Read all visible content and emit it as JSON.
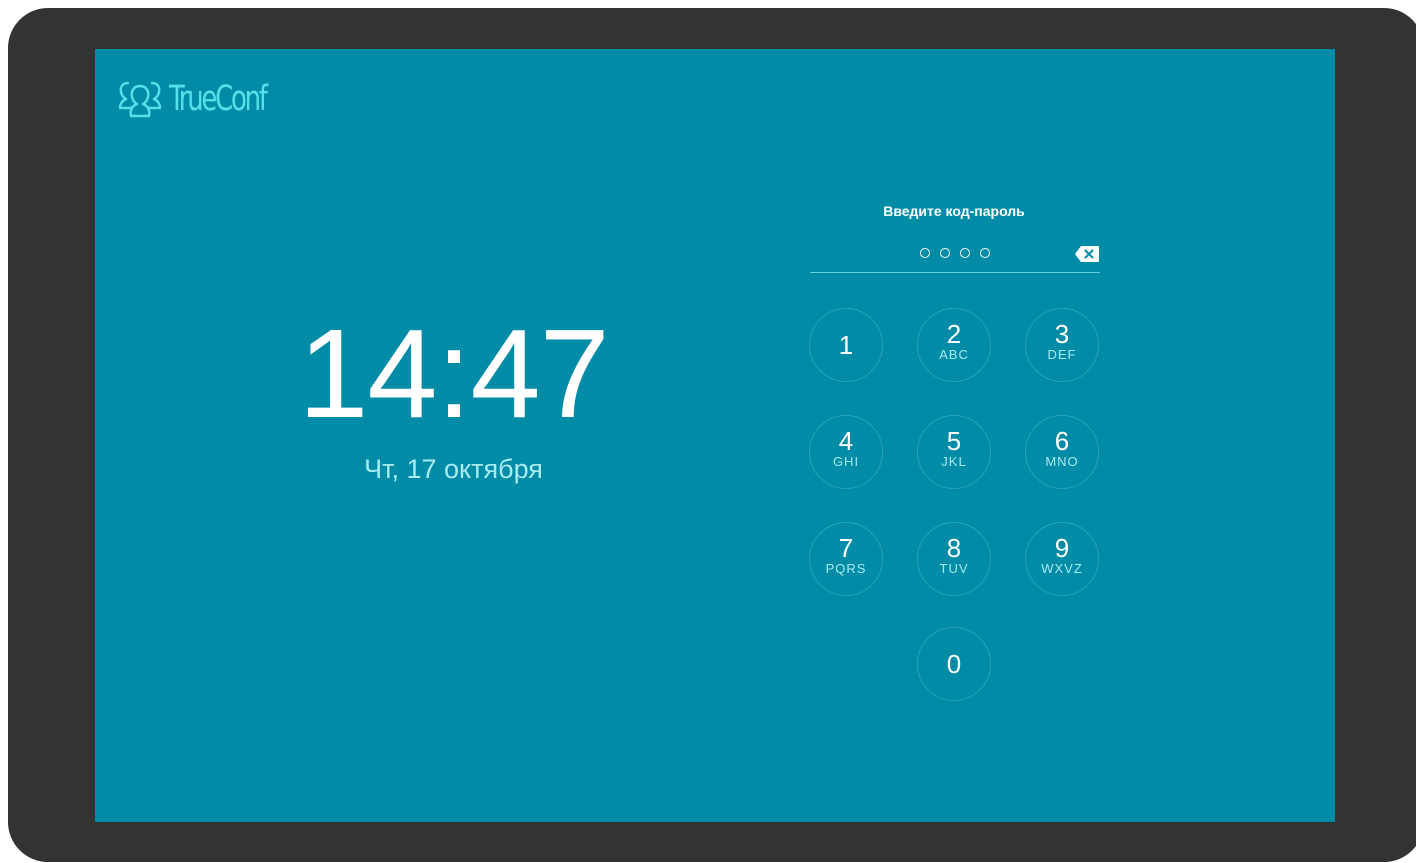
{
  "app": {
    "brand": "TrueConf"
  },
  "clock": {
    "time": "14:47",
    "date": "Чт, 17 октября"
  },
  "pin": {
    "prompt": "Введите код-пароль",
    "entered_digits": 0,
    "max_digits": 4
  },
  "keypad": {
    "keys": [
      {
        "digit": "1",
        "letters": ""
      },
      {
        "digit": "2",
        "letters": "ABC"
      },
      {
        "digit": "3",
        "letters": "DEF"
      },
      {
        "digit": "4",
        "letters": "GHI"
      },
      {
        "digit": "5",
        "letters": "JKL"
      },
      {
        "digit": "6",
        "letters": "MNO"
      },
      {
        "digit": "7",
        "letters": "PQRS"
      },
      {
        "digit": "8",
        "letters": "TUV"
      },
      {
        "digit": "9",
        "letters": "WXVZ"
      },
      {
        "digit": "0",
        "letters": ""
      }
    ]
  },
  "icons": {
    "logo": "people-group-icon",
    "backspace": "backspace-icon"
  },
  "colors": {
    "bezel": "#333333",
    "screen_background": "#008ba7",
    "accent": "#57e0ea",
    "secondary_text": "#a8ecf2",
    "key_border": "#2aa1bc"
  }
}
